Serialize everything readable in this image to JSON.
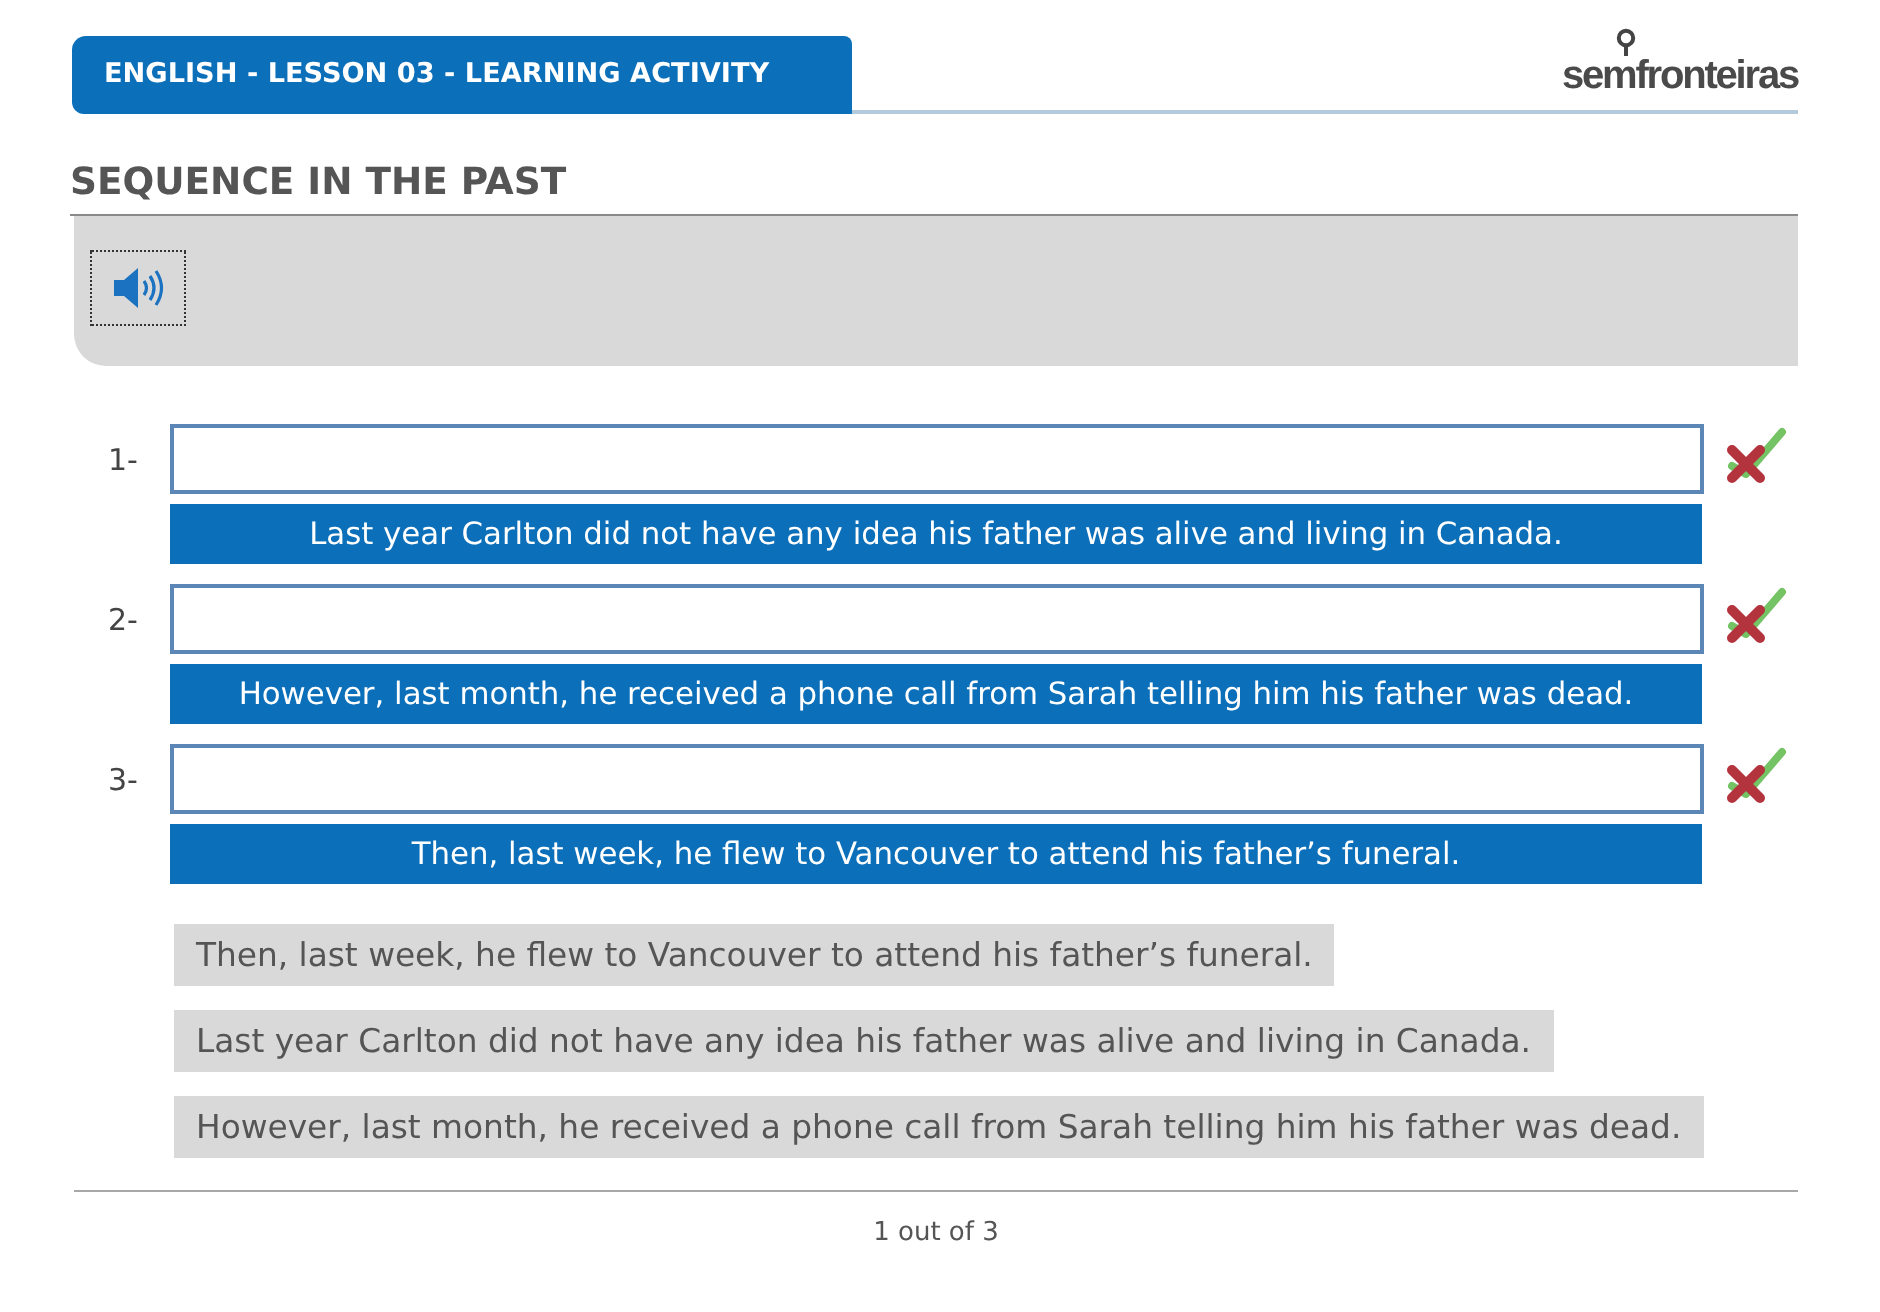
{
  "header": {
    "title": "ENGLISH - LESSON 03 - LEARNING ACTIVITY",
    "logo": "semfronteiras"
  },
  "section_title": "SEQUENCE IN THE PAST",
  "answer_slots": [
    {
      "number": "1-",
      "sentence": "Last year Carlton did not have any idea his father was alive and living in Canada."
    },
    {
      "number": "2-",
      "sentence": "However, last month, he received a phone call from Sarah telling him his father was dead."
    },
    {
      "number": "3-",
      "sentence": "Then, last week, he flew to Vancouver to attend his father’s funeral."
    }
  ],
  "sentence_options": [
    "Then, last week, he flew to Vancouver to attend his father’s funeral.",
    "Last year Carlton did not have any idea his father was alive and living in Canada.",
    "However, last month, he received a phone call from Sarah telling him his father was dead."
  ],
  "pagination": "1 out of 3"
}
